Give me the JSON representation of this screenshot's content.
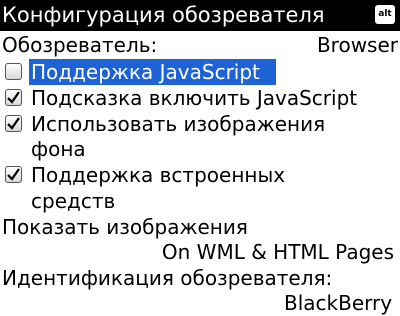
{
  "title_bar": {
    "title": "Конфигурация обозревателя",
    "alt_icon": "alt"
  },
  "browser_row": {
    "label": "Обозреватель:",
    "value": "Browser"
  },
  "options": [
    {
      "label": "Поддержка JavaScript",
      "checked": false,
      "selected": true
    },
    {
      "label": "Подсказка включить JavaScript",
      "checked": true,
      "selected": false
    },
    {
      "label_line1": "Использовать изображения",
      "label_line2": "фона",
      "checked": true,
      "selected": false
    },
    {
      "label_line1": "Поддержка встроенных",
      "label_line2": "средств",
      "checked": true,
      "selected": false
    }
  ],
  "show_images": {
    "label": "Показать изображения",
    "value": "On WML & HTML Pages"
  },
  "browser_id": {
    "label": "Идентификация обозревателя:",
    "value": "BlackBerry"
  },
  "colors": {
    "title_bg": "#000000",
    "selection": "#1e63d6"
  },
  "icons": {
    "checkbox_checked": "checkmark-icon"
  }
}
